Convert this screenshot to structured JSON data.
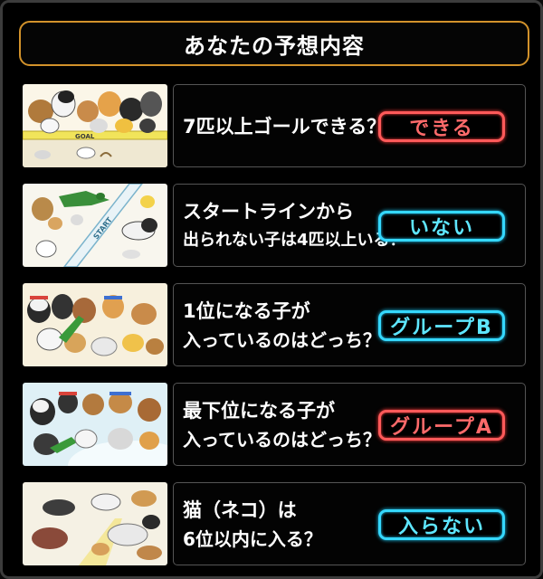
{
  "header": {
    "title": "あなたの予想内容"
  },
  "colors": {
    "title_border": "#d2922b",
    "answer_red": "#ff5a5a",
    "answer_blue": "#35d8ff"
  },
  "questions": [
    {
      "line1": "7匹以上ゴールできる？",
      "line2": "",
      "answer": "できる",
      "answer_color": "red",
      "thumb_text": "GOAL",
      "thumb_icon": "goal-group-illustration-icon"
    },
    {
      "line1": "スタートラインから",
      "line2": "出られない子は4匹以上いる？",
      "answer": "いない",
      "answer_color": "blue",
      "thumb_text": "START",
      "thumb_icon": "start-line-illustration-icon"
    },
    {
      "line1": "1位になる子が",
      "line2": "入っているのはどっち？",
      "answer": "グループB",
      "answer_color": "blue",
      "thumb_text": "",
      "thumb_icon": "group-b-illustration-icon"
    },
    {
      "line1": "最下位になる子が",
      "line2": "入っているのはどっち？",
      "answer": "グループA",
      "answer_color": "red",
      "thumb_text": "",
      "thumb_icon": "group-a-illustration-icon"
    },
    {
      "line1": "猫（ネコ）は",
      "line2": "6位以内に入る？",
      "answer": "入らない",
      "answer_color": "blue",
      "thumb_text": "",
      "thumb_icon": "cat-race-illustration-icon"
    }
  ]
}
